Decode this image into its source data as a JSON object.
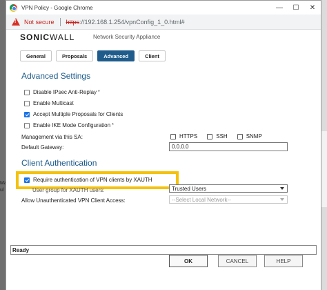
{
  "window": {
    "title": "VPN Policy - Google Chrome",
    "controls": {
      "minimize": "—",
      "maximize": "☐",
      "close": "✕"
    }
  },
  "address": {
    "security_text": "Not secure",
    "url_scheme": "https",
    "url_rest": "://192.168.1.254/vpnConfig_1_0.html#"
  },
  "header": {
    "logo_bold": "SONIC",
    "logo_thin": "WALL",
    "subtitle": "Network Security Appliance"
  },
  "tabs": [
    {
      "label": "General",
      "active": false
    },
    {
      "label": "Proposals",
      "active": false
    },
    {
      "label": "Advanced",
      "active": true
    },
    {
      "label": "Client",
      "active": false
    }
  ],
  "advanced": {
    "title": "Advanced Settings",
    "options": [
      {
        "label": "Disable IPsec Anti-Replay",
        "checked": false,
        "asterisk": "*"
      },
      {
        "label": "Enable Multicast",
        "checked": false,
        "asterisk": ""
      },
      {
        "label": "Accept Multiple Proposals for Clients",
        "checked": true,
        "asterisk": ""
      },
      {
        "label": "Enable IKE Mode Configuration",
        "checked": false,
        "asterisk": "*"
      }
    ],
    "management_label": "Management via this SA:",
    "management_options": [
      {
        "label": "HTTPS",
        "checked": false
      },
      {
        "label": "SSH",
        "checked": false
      },
      {
        "label": "SNMP",
        "checked": false
      }
    ],
    "gateway_label": "Default Gateway:",
    "gateway_value": "0.0.0.0"
  },
  "client": {
    "title": "Client Authentication",
    "xauth_label": "Require authentication of VPN clients by XAUTH",
    "xauth_checked": true,
    "user_group_label": "User group for XAUTH users:",
    "user_group_value": "Trusted Users",
    "unauth_label": "Allow Unauthenticated VPN Client Access:",
    "unauth_value": "--Select Local Network--"
  },
  "status": {
    "text": "Ready"
  },
  "buttons": {
    "ok": "OK",
    "cancel": "CANCEL",
    "help": "HELP"
  },
  "background": {
    "fragment_1": "Ma",
    "fragment_2": "ul"
  },
  "colors": {
    "accent": "#1f5c8c",
    "section_title": "#1a5a8a",
    "highlight": "#f4c20d",
    "warning": "#c5221f"
  }
}
